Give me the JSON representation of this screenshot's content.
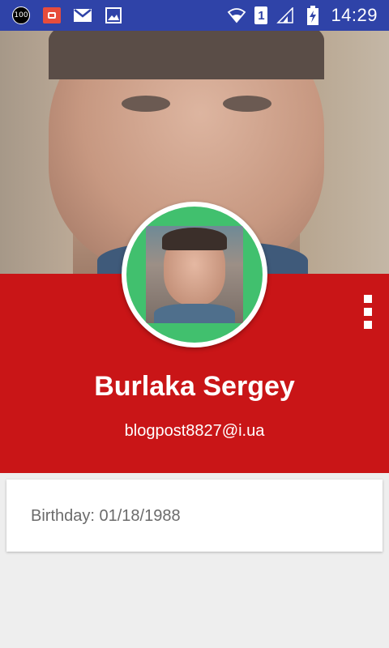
{
  "status_bar": {
    "battery_badge": "100",
    "sim_slot": "1",
    "time": "14:29",
    "icons": [
      "battery-100-icon",
      "notification-icon",
      "gmail-icon",
      "image-icon",
      "wifi-icon",
      "sim-icon",
      "signal-icon",
      "battery-charging-icon"
    ]
  },
  "profile": {
    "name": "Burlaka Sergey",
    "email": "blogpost8827@i.ua"
  },
  "details": {
    "birthday": "Birthday: 01/18/1988"
  },
  "colors": {
    "status_bar": "#2f43a8",
    "header": "#c91517",
    "avatar_ring": "#41c06e",
    "background": "#eeeeee"
  }
}
